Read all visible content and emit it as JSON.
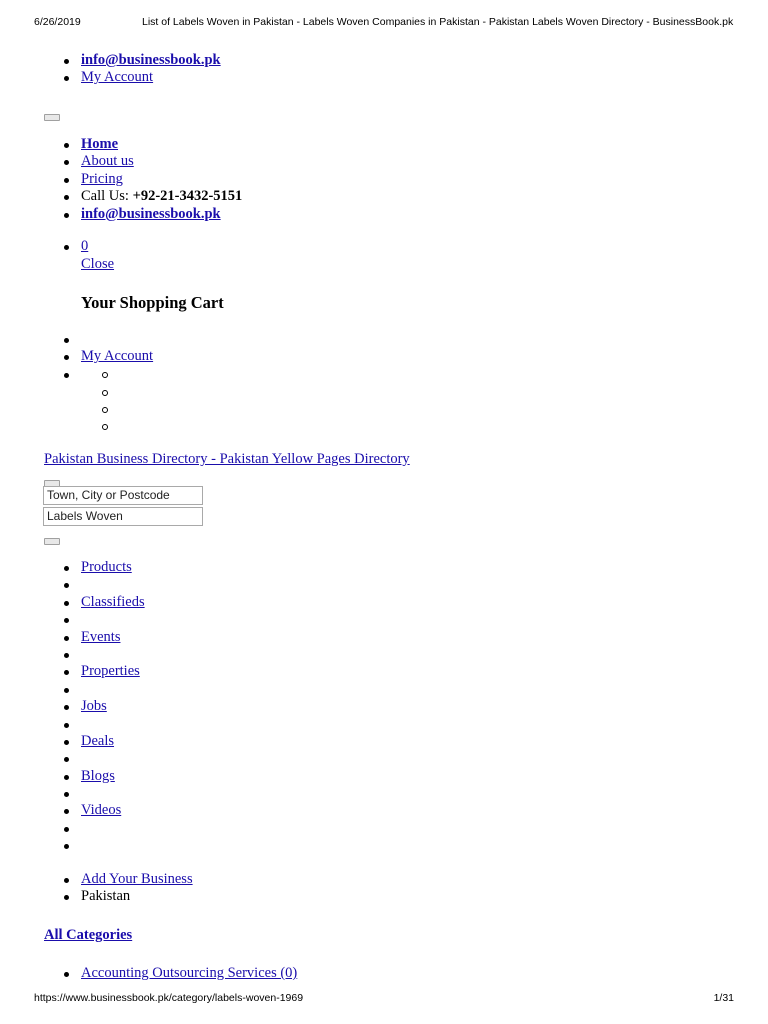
{
  "print_header": {
    "date": "6/26/2019",
    "title": "List of Labels Woven in Pakistan - Labels Woven Companies in Pakistan - Pakistan Labels Woven Directory - BusinessBook.pk"
  },
  "top_links": {
    "email": "info@businessbook.pk",
    "account": "My Account"
  },
  "main_nav": {
    "home": "Home",
    "about": "About us",
    "pricing": "Pricing",
    "call_label": "Call Us: ",
    "call_number": "+92-21-3432-5151",
    "email": "info@businessbook.pk"
  },
  "cart": {
    "count": "0",
    "close": "Close",
    "title": "Your Shopping Cart"
  },
  "account_menu": {
    "account": "My Account"
  },
  "directory_link": "Pakistan Business Directory - Pakistan Yellow Pages Directory",
  "search": {
    "location_value": "Town, City or Postcode",
    "keyword_value": "Labels Woven"
  },
  "section_nav": {
    "items": [
      "Products",
      "Classifieds",
      "Events",
      "Properties",
      "Jobs",
      "Deals",
      "Blogs",
      "Videos"
    ]
  },
  "business": {
    "add": "Add Your Business",
    "country": "Pakistan"
  },
  "all_categories": "All Categories",
  "categories": [
    "Accounting Outsourcing Services (0)"
  ],
  "print_footer": {
    "url": "https://www.businessbook.pk/category/labels-woven-1969",
    "page": "1/31"
  }
}
